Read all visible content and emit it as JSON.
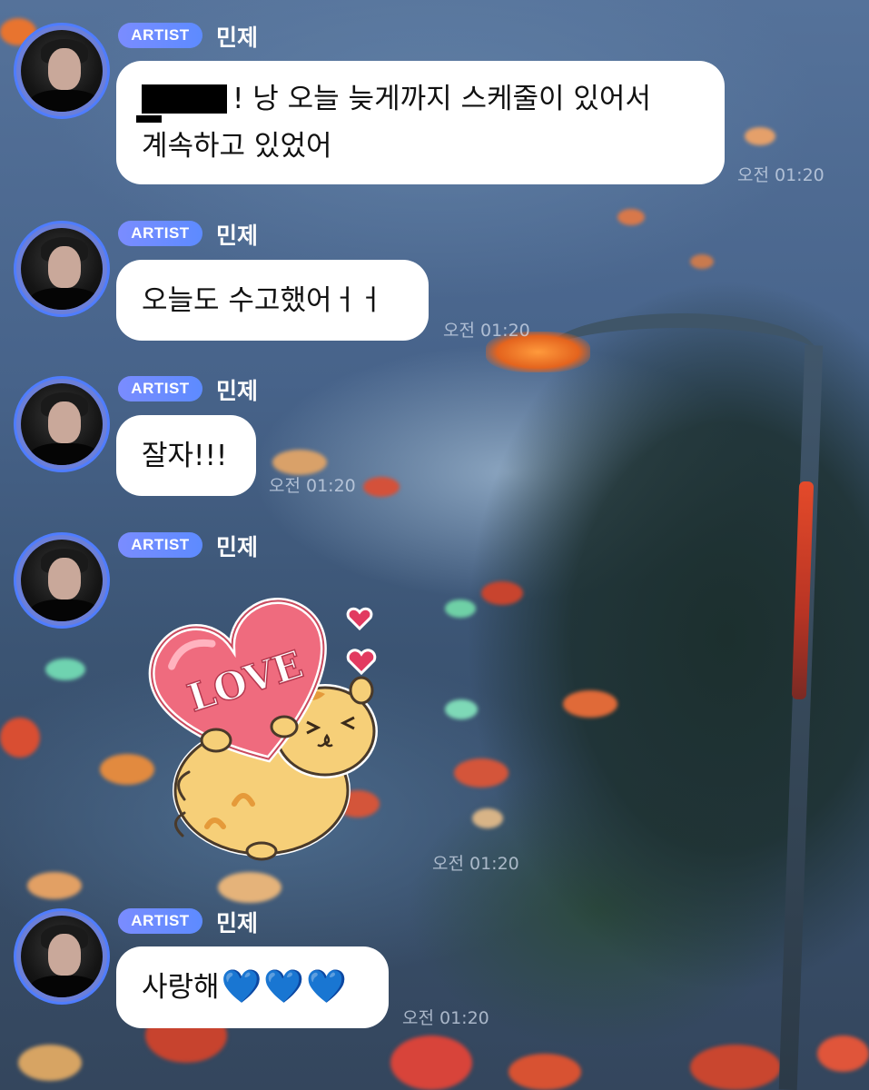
{
  "chat": {
    "messages": [
      {
        "badge": "ARTIST",
        "name": "민제",
        "text_line1": "! 낭 오늘 늦게까지 스케줄이 있어서",
        "text_line2": "계속하고 있었어",
        "time": "오전 01:20"
      },
      {
        "badge": "ARTIST",
        "name": "민제",
        "text": "오늘도 수고했어ㅓㅓ",
        "time": "오전 01:20"
      },
      {
        "badge": "ARTIST",
        "name": "민제",
        "text": "잘자!!!",
        "time": "오전 01:20"
      },
      {
        "badge": "ARTIST",
        "name": "민제",
        "sticker_text": "LOVE",
        "time": "오전 01:20"
      },
      {
        "badge": "ARTIST",
        "name": "민제",
        "text": "사랑해",
        "hearts": [
          "💙",
          "💙",
          "💙"
        ],
        "time": "오전 01:20"
      }
    ]
  },
  "colors": {
    "badge": "#5d8bff",
    "avatar_ring": "#4f7dff",
    "bubble": "#ffffff",
    "heart_emoji": "#2d7cf3"
  },
  "icons": {
    "sticker": "hamster-holding-love-heart-sticker",
    "avatar": "artist-profile-photo"
  }
}
